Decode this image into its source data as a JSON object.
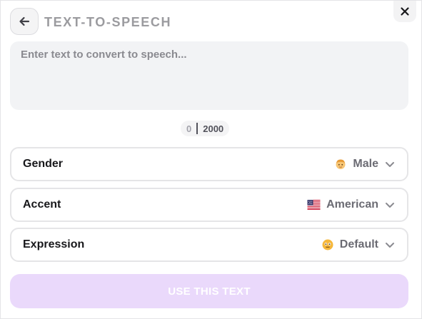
{
  "header": {
    "title": "TEXT-TO-SPEECH",
    "back_icon": "arrow-left-icon",
    "close_icon": "close-icon"
  },
  "editor": {
    "placeholder": "Enter text to convert to speech...",
    "value": ""
  },
  "counter": {
    "current": "0",
    "max": "2000"
  },
  "options": [
    {
      "label": "Gender",
      "value": "Male",
      "icon": "male-emoji-icon"
    },
    {
      "label": "Accent",
      "value": "American",
      "icon": "us-flag-icon"
    },
    {
      "label": "Expression",
      "value": "Default",
      "icon": "neutral-face-icon"
    }
  ],
  "actions": {
    "use_label": "USE THIS TEXT"
  },
  "colors": {
    "accent_disabled": "#ead9fb",
    "title_gray": "#9b9b9f"
  }
}
